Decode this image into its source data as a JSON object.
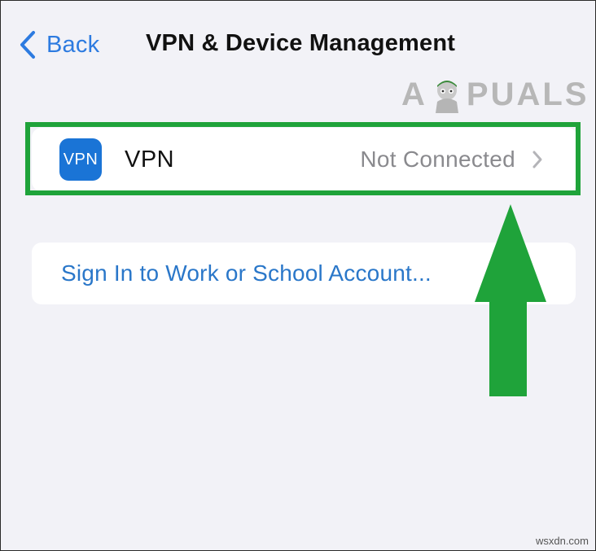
{
  "nav": {
    "back_label": "Back",
    "title": "VPN & Device Management"
  },
  "watermark": {
    "brand_left": "A",
    "brand_right": "PUALS"
  },
  "vpn_row": {
    "icon_text": "VPN",
    "label": "VPN",
    "status": "Not Connected",
    "icon": "chevron-right-icon"
  },
  "sign_in": {
    "label": "Sign In to Work or School Account..."
  },
  "annotation": {
    "highlight_color": "#1fa33a",
    "arrow_color": "#1fa33a",
    "arrow_direction": "up"
  },
  "footer": {
    "credit": "wsxdn.com"
  },
  "colors": {
    "accent": "#2d7be0",
    "background": "#f2f2f7",
    "vpn_badge": "#1a74d6"
  }
}
